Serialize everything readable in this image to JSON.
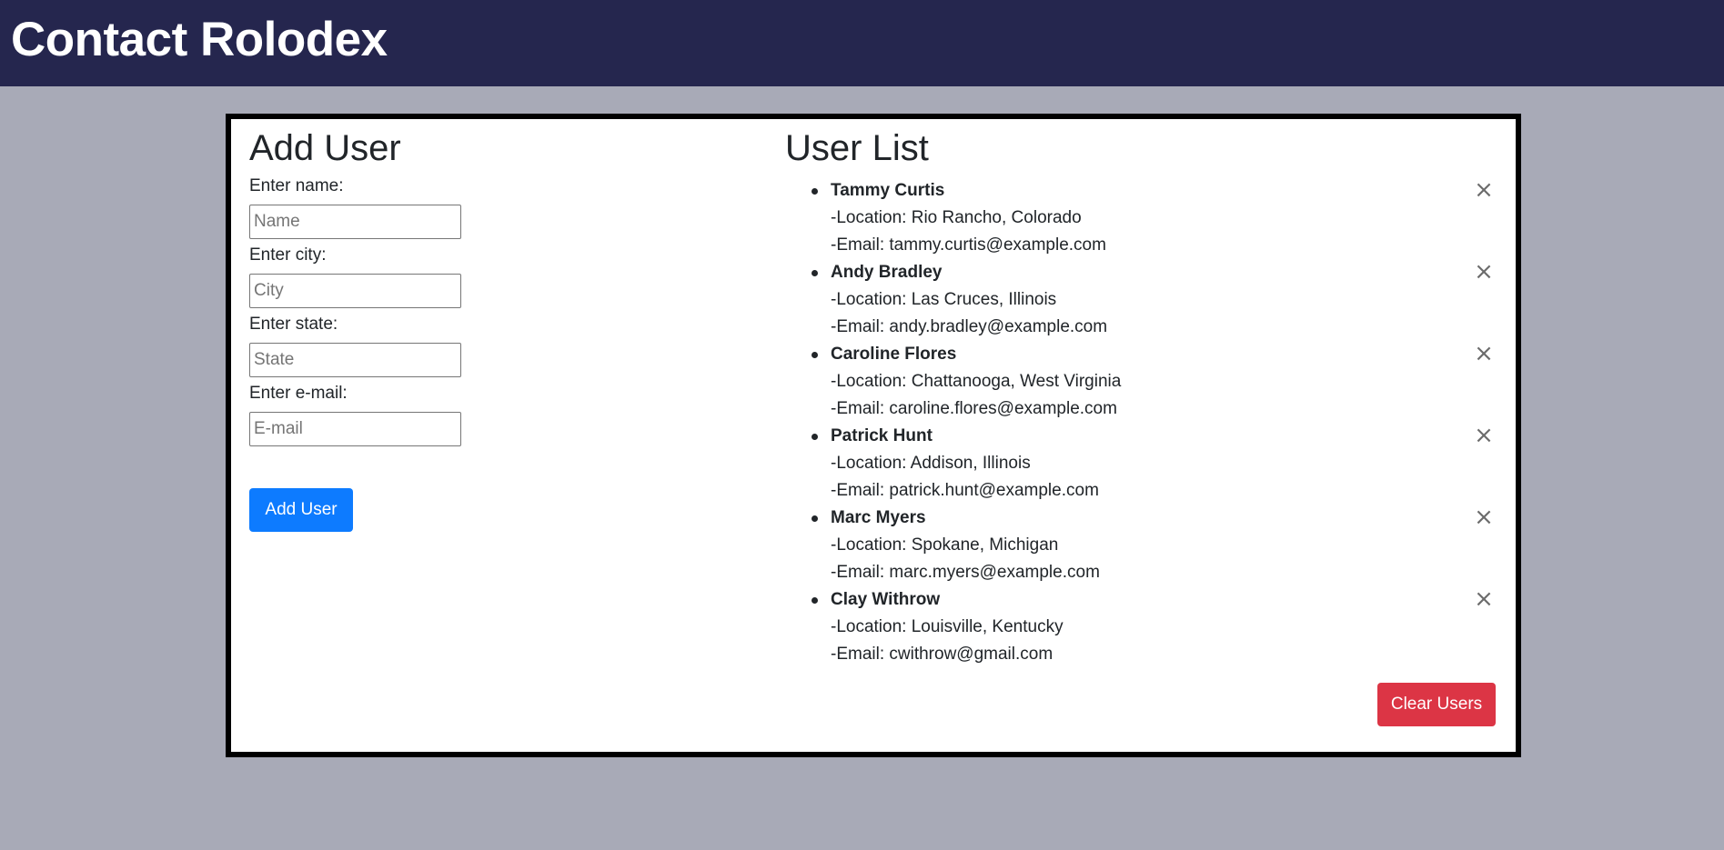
{
  "header": {
    "title": "Contact Rolodex"
  },
  "add_user": {
    "title": "Add User",
    "fields": [
      {
        "label": "Enter name:",
        "placeholder": "Name",
        "value": ""
      },
      {
        "label": "Enter city:",
        "placeholder": "City",
        "value": ""
      },
      {
        "label": "Enter state:",
        "placeholder": "State",
        "value": ""
      },
      {
        "label": "Enter e-mail:",
        "placeholder": "E-mail",
        "value": ""
      }
    ],
    "button_label": "Add User",
    "button_color": "#0d7bff"
  },
  "user_list": {
    "title": "User List",
    "remove_icon": "×",
    "users": [
      {
        "name": "Tammy Curtis",
        "location": "-Location: Rio Rancho, Colorado",
        "email": "-Email: tammy.curtis@example.com"
      },
      {
        "name": "Andy Bradley",
        "location": "-Location: Las Cruces, Illinois",
        "email": "-Email: andy.bradley@example.com"
      },
      {
        "name": "Caroline Flores",
        "location": "-Location: Chattanooga, West Virginia",
        "email": "-Email: caroline.flores@example.com"
      },
      {
        "name": "Patrick Hunt",
        "location": "-Location: Addison, Illinois",
        "email": "-Email: patrick.hunt@example.com"
      },
      {
        "name": "Marc Myers",
        "location": "-Location: Spokane, Michigan",
        "email": "-Email: marc.myers@example.com"
      },
      {
        "name": "Clay Withrow",
        "location": "-Location: Louisville, Kentucky",
        "email": "-Email: cwithrow@gmail.com"
      }
    ],
    "clear_label": "Clear Users",
    "clear_color": "#dc3545"
  },
  "colors": {
    "navbar": "#25264e",
    "page_background": "#a8aab7",
    "card_border": "#000000"
  }
}
